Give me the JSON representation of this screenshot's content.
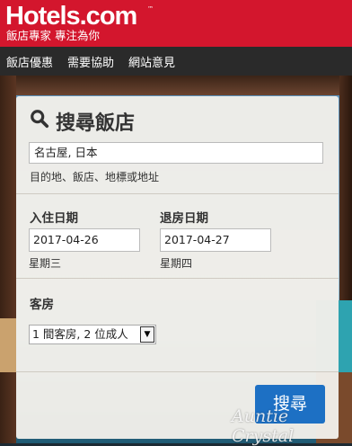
{
  "header": {
    "brand": "Hotels.com",
    "brand_tm": "™",
    "tagline": "飯店專家 專注為你",
    "background_color": "#d3162d"
  },
  "nav": {
    "items": [
      {
        "label": "飯店優惠"
      },
      {
        "label": "需要協助"
      },
      {
        "label": "網站意見"
      }
    ]
  },
  "search": {
    "title": "搜尋飯店",
    "title_icon": "search-icon",
    "destination_value": "名古屋, 日本",
    "destination_hint": "目的地、飯店、地標或地址",
    "checkin_label": "入住日期",
    "checkin_value": "2017-04-26",
    "checkin_weekday": "星期三",
    "checkout_label": "退房日期",
    "checkout_value": "2017-04-27",
    "checkout_weekday": "星期四",
    "rooms_label": "客房",
    "rooms_value": "1 間客房, 2 位成人",
    "submit_label": "搜尋",
    "button_color": "#1d70c4"
  },
  "watermark": "Auntie Crystal"
}
